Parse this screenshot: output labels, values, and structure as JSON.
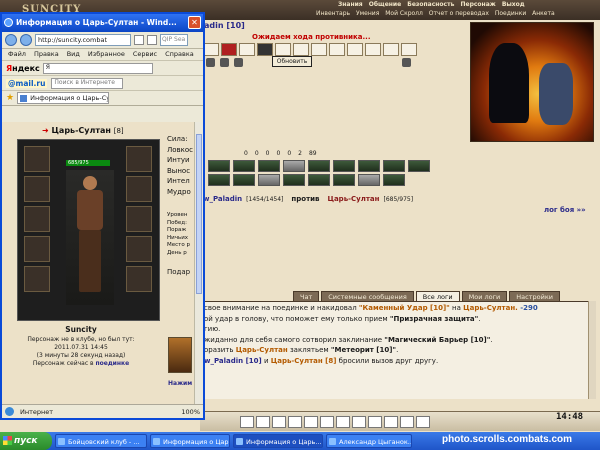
{
  "game": {
    "logo": "SUNCITY",
    "menu": [
      "Знания",
      "Общение",
      "Безопасность",
      "Персонаж",
      "Выход"
    ],
    "submenu": [
      "Инвентарь",
      "Умения",
      "Мой Скролл",
      "Отчет о переводах",
      "Поединки",
      "Анкета"
    ],
    "opponent_header": "adin [10]",
    "waiting_text": "Ожидаем хода противника...",
    "refresh_label": "Обновить",
    "stat_counters": [
      "0",
      "0",
      "0",
      "0",
      "0",
      "2",
      "89"
    ],
    "duel": {
      "player_name": "w_Paladin",
      "player_hp": "[1454/1454]",
      "versus": "против",
      "enemy_name": "Царь-Султан",
      "enemy_hp": "[685/975]"
    },
    "log_link": "лог боя »»",
    "tabs": [
      "Чат",
      "Системные сообщения",
      "Все логи",
      "Мои логи",
      "Настройки"
    ],
    "active_tab": "Все логи",
    "log_lines": [
      {
        "pre": "свое внимание на поединке и накидовал ",
        "hl": "\"Каменный Удар [10]\"",
        "mid": " на ",
        "target": "Царь-Султан.",
        "num": " -290"
      },
      {
        "pre": "ой удар в голову, что поможет ему только прием ",
        "bold": "\"Призрачная защита\"",
        "end": "."
      },
      {
        "pre": "гию."
      },
      {
        "pre": "жиданно для себя самого сотворил заклинание ",
        "bold": "\"Магический Барьер [10]\"",
        "end": "."
      },
      {
        "pre": "оразить ",
        "target": "Царь-Султан",
        "mid": " заклятьем ",
        "bold": "\"Метеорит [10]\"",
        "end": "."
      },
      {
        "player": "w_Paladin [10]",
        "mid": " и ",
        "target": "Царь-Султан [8]",
        "end": " бросили вызов друг другу."
      }
    ],
    "clock": "14:48"
  },
  "popup": {
    "title": "Информация о Царь-Султан - Wind...",
    "address": "http://suncity.combat",
    "live_search": "QIP Sea",
    "menu": [
      "Файл",
      "Правка",
      "Вид",
      "Избранное",
      "Сервис",
      "Справка"
    ],
    "yandex_logo_a": "Я",
    "yandex_logo_b": "ндекс",
    "yandex_input": "Я",
    "mail_logo": "@mail.ru",
    "mail_search_placeholder": "Поиск в Интернете",
    "tab_title": "Информация о Царь-Сул...",
    "character": {
      "name": "Царь-Султан",
      "level": "[8]",
      "hp": "685/975",
      "stats": [
        "Сила:",
        "Ловкос",
        "Интуи",
        "Вынос",
        "Интел",
        "Мудро"
      ],
      "stats2": [
        "Уровен",
        "Побед:",
        "Пораж",
        "Ничьих",
        "Место р",
        "День р"
      ],
      "side_label": "Подар",
      "clan": "Suncity",
      "info1": "Персонаж не в клубе, но был тут:",
      "info2": "2011.07.31 14:45",
      "info3": "(3 минуты 28 секунд назад)",
      "online_pre": "Персонаж сейчас в ",
      "online_link": "поединке",
      "side_link": "Нажим"
    },
    "status_text": "Интернет",
    "zoom": "100%"
  },
  "taskbar": {
    "start": "пуск",
    "tasks": [
      "Бойцовский клуб - ...",
      "Информация о Царь...",
      "Информация о Царь...",
      "Александр Цыганок..."
    ],
    "watermark": "photo.scrolls.combats.com"
  }
}
